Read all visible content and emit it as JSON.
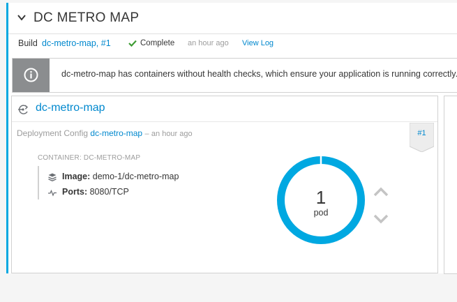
{
  "app": {
    "title": "DC METRO MAP"
  },
  "build": {
    "label": "Build",
    "link_text": "dc-metro-map, #1",
    "status": "Complete",
    "time": "an hour ago",
    "view_log": "View Log"
  },
  "alert": {
    "message": "dc-metro-map has containers without health checks, which ensure your application is running correctly."
  },
  "deployment": {
    "name": "dc-metro-map",
    "config_label": "Deployment Config",
    "config_link": "dc-metro-map",
    "separator": "–",
    "time": "an hour ago",
    "badge": "#1",
    "container_label": "CONTAINER: DC-METRO-MAP",
    "image_label": "Image:",
    "image_value": "demo-1/dc-metro-map",
    "ports_label": "Ports:",
    "ports_value": "8080/TCP",
    "pod_count": "1",
    "pod_label": "pod"
  },
  "colors": {
    "accent": "#00a8e1",
    "link": "#0088ce",
    "success": "#3f9c35",
    "alert_icon_bg": "#8b8d8f"
  },
  "icons": {
    "collapse": "chevron-down-icon",
    "status": "check-icon",
    "alert": "info-icon",
    "deployment": "deployment-rollout-icon",
    "image": "layers-icon",
    "ports": "pulse-icon",
    "scale_up": "chevron-up-icon",
    "scale_down": "chevron-down-icon"
  }
}
